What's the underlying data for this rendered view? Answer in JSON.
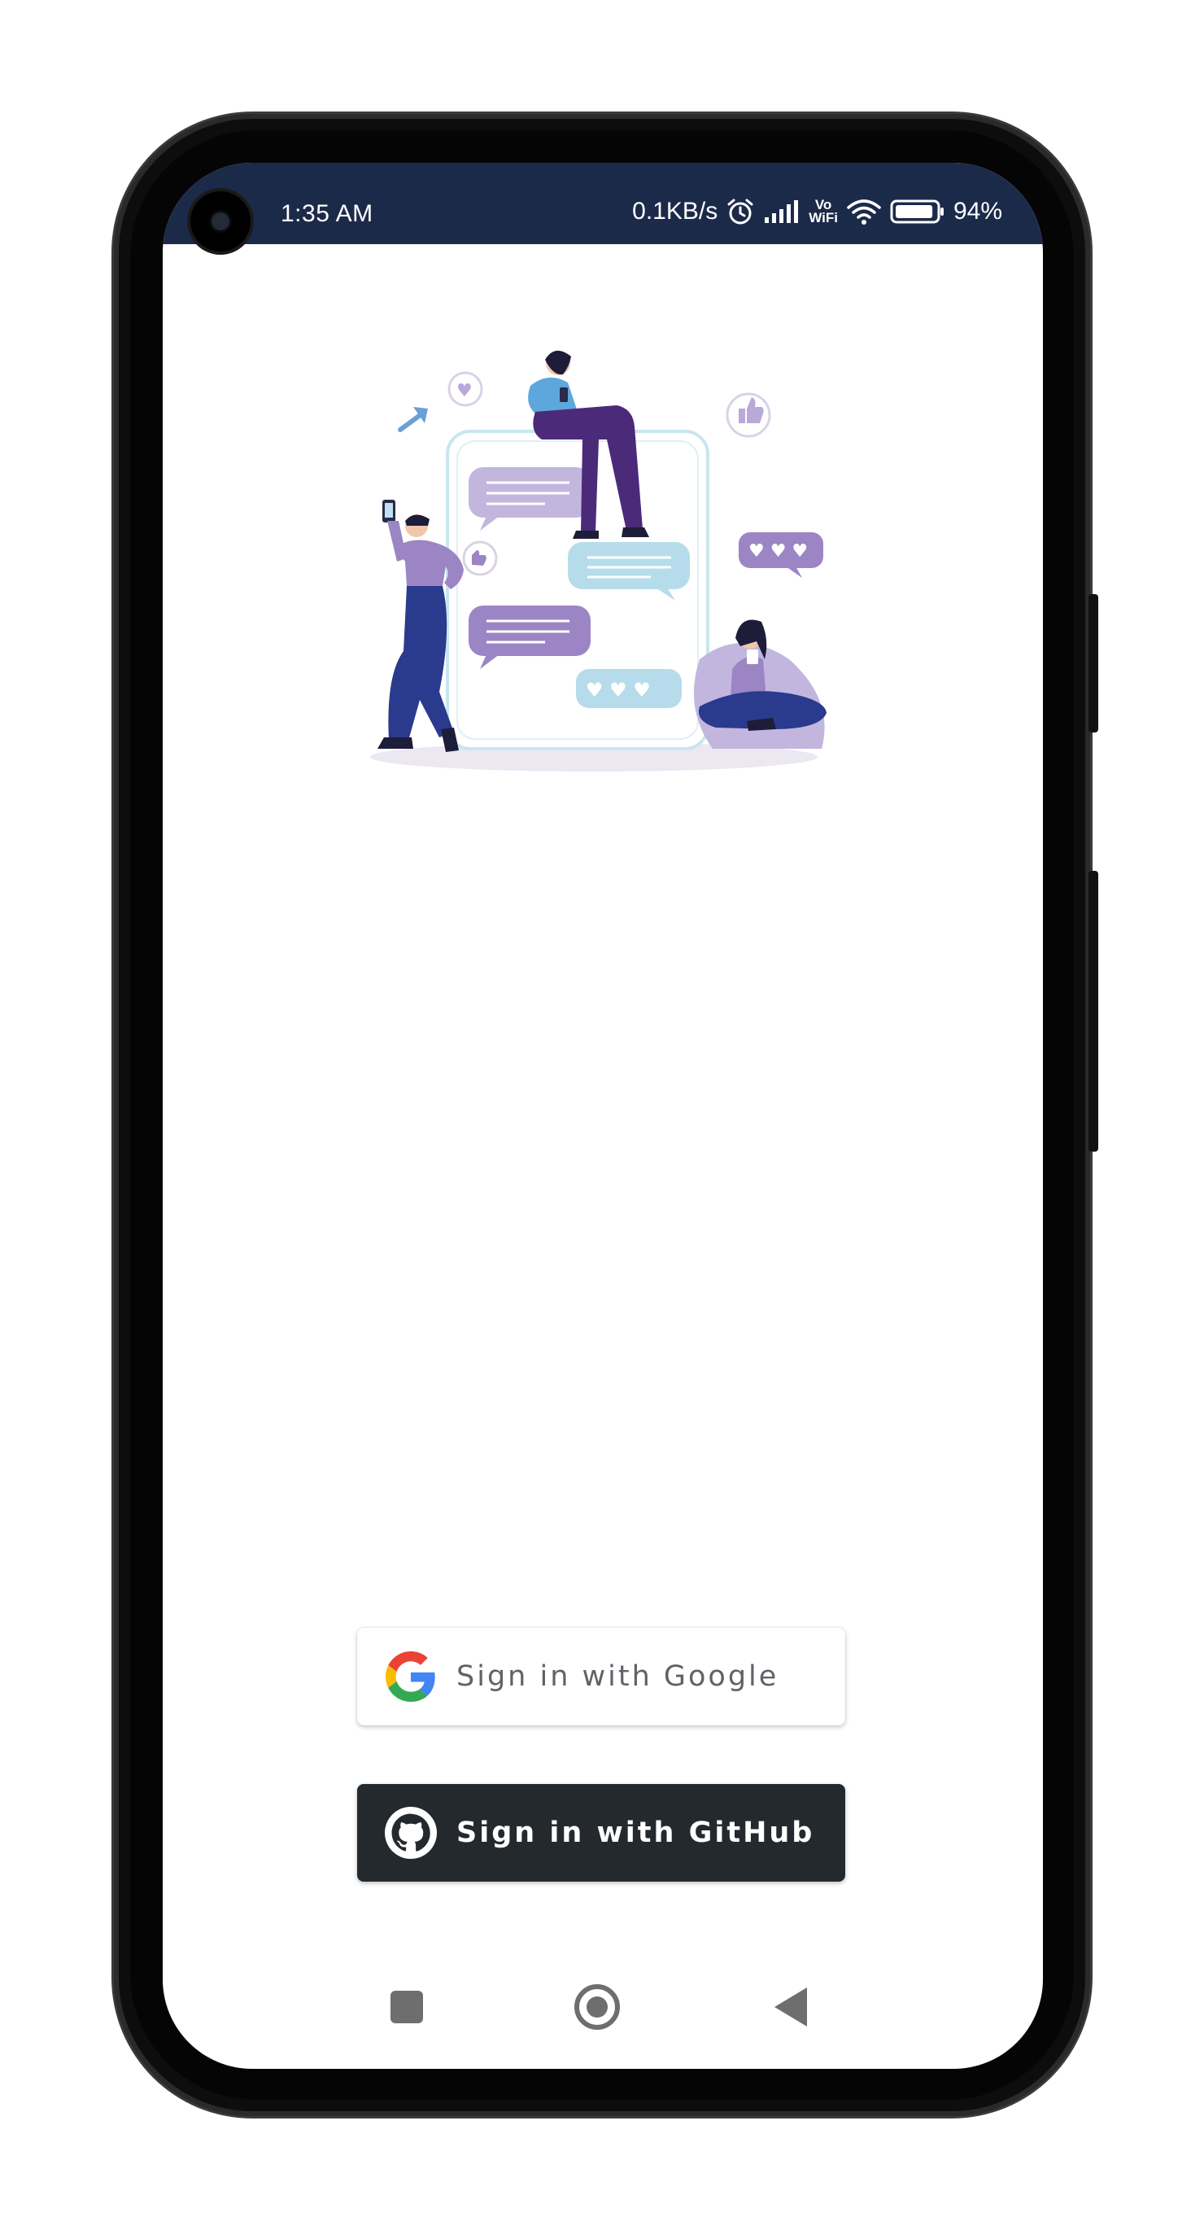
{
  "status_bar": {
    "time": "1:35 AM",
    "net_speed": "0.1KB/s",
    "vowifi_top": "Vo",
    "vowifi_bottom": "WiFi",
    "battery_level": "94%",
    "battery_fraction": 0.94,
    "background_color": "#1c2a4a",
    "icons": [
      "alarm-icon",
      "signal-icon",
      "vowifi-icon",
      "wifi-icon",
      "battery-icon"
    ]
  },
  "hero": {
    "image": "people-chatting-illustration",
    "palette": {
      "purple": "#9a83c2",
      "lavender": "#c2b6df",
      "navy": "#2a3a8c",
      "light_blue": "#a9d4e5",
      "dark_purple": "#4b2a7a"
    }
  },
  "auth": {
    "google_label": "Sign in with Google",
    "github_label": "Sign in with GitHub",
    "google_icon": "google-logo-icon",
    "github_icon": "github-logo-icon",
    "github_bg": "#24292e"
  },
  "nav": {
    "items": [
      "recents-button",
      "home-button",
      "back-button"
    ]
  }
}
